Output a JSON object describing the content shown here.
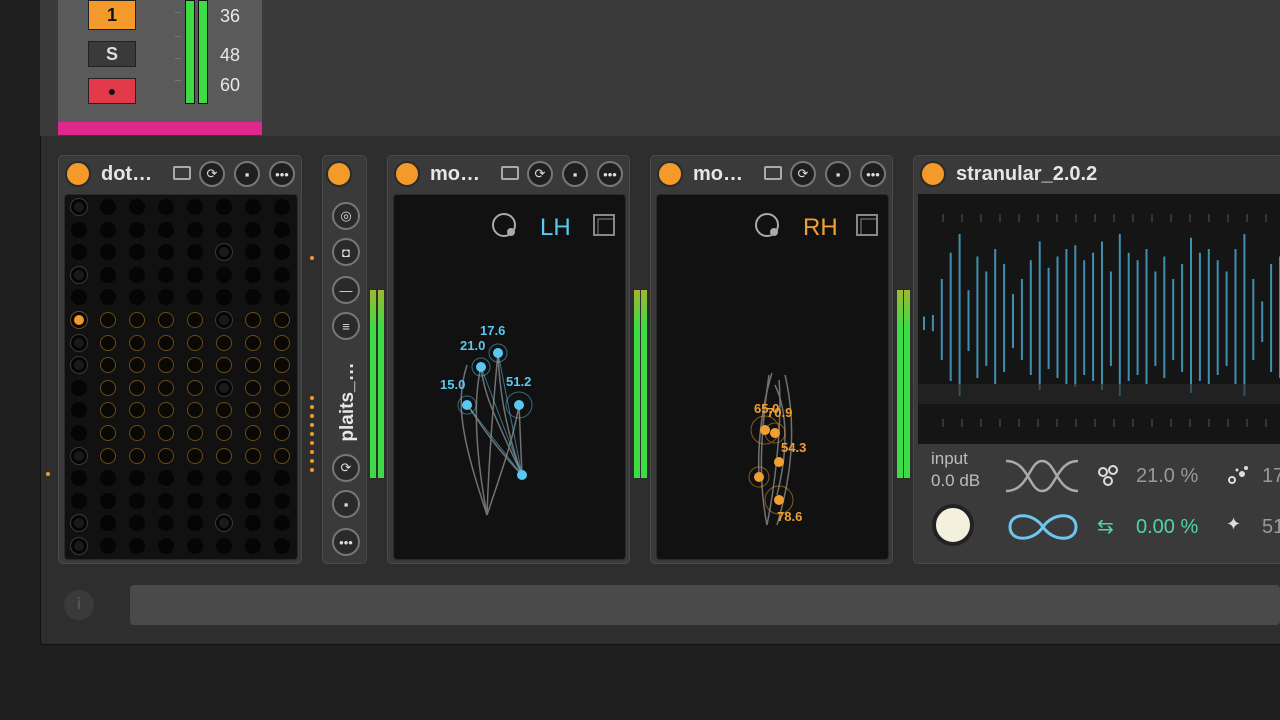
{
  "track": {
    "button_1": "1",
    "button_solo": "S",
    "button_record": "●",
    "db_labels": [
      "36",
      "48",
      "60"
    ],
    "color": "#e0288c"
  },
  "devices": {
    "dot": {
      "title": "dot…"
    },
    "plaits": {
      "title": "plaits_…"
    },
    "mo_lh": {
      "title": "mo…",
      "hand": "LH",
      "values": [
        "17.6",
        "21.0",
        "15.0",
        "51.2"
      ]
    },
    "mo_rh": {
      "title": "mo…",
      "hand": "RH",
      "values": [
        "65.0",
        "70.9",
        "54.3",
        "78.6"
      ]
    },
    "stranular": {
      "title": "stranular_2.0.2",
      "input_label": "input",
      "input_value": "0.0 dB",
      "param1": "21.0 %",
      "param2": "0.00 %",
      "param3": "17",
      "param4": "51"
    }
  },
  "colors": {
    "accent": "#f39a2a",
    "lh": "#5bc8f0",
    "rh": "#f0a030",
    "meter": "#3ddc45"
  }
}
